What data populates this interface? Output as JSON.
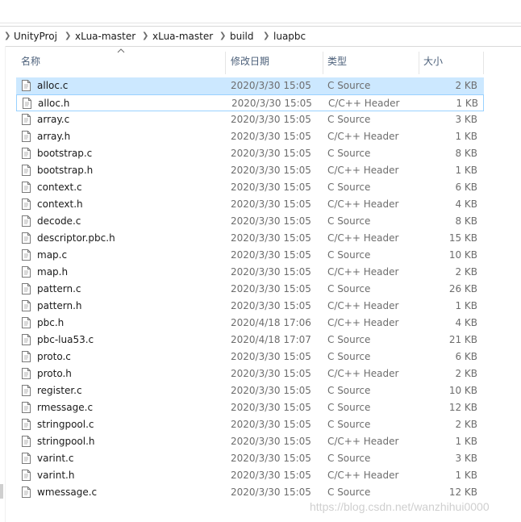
{
  "breadcrumb": [
    "UnityProj",
    "xLua-master",
    "xLua-master",
    "build",
    "luapbc"
  ],
  "columns": {
    "name": "名称",
    "date": "修改日期",
    "type": "类型",
    "size": "大小"
  },
  "files": [
    {
      "name": "alloc.c",
      "date": "2020/3/30 15:05",
      "type": "C Source",
      "size": "2 KB"
    },
    {
      "name": "alloc.h",
      "date": "2020/3/30 15:05",
      "type": "C/C++ Header",
      "size": "1 KB"
    },
    {
      "name": "array.c",
      "date": "2020/3/30 15:05",
      "type": "C Source",
      "size": "3 KB"
    },
    {
      "name": "array.h",
      "date": "2020/3/30 15:05",
      "type": "C/C++ Header",
      "size": "1 KB"
    },
    {
      "name": "bootstrap.c",
      "date": "2020/3/30 15:05",
      "type": "C Source",
      "size": "8 KB"
    },
    {
      "name": "bootstrap.h",
      "date": "2020/3/30 15:05",
      "type": "C/C++ Header",
      "size": "1 KB"
    },
    {
      "name": "context.c",
      "date": "2020/3/30 15:05",
      "type": "C Source",
      "size": "6 KB"
    },
    {
      "name": "context.h",
      "date": "2020/3/30 15:05",
      "type": "C/C++ Header",
      "size": "4 KB"
    },
    {
      "name": "decode.c",
      "date": "2020/3/30 15:05",
      "type": "C Source",
      "size": "8 KB"
    },
    {
      "name": "descriptor.pbc.h",
      "date": "2020/3/30 15:05",
      "type": "C/C++ Header",
      "size": "15 KB"
    },
    {
      "name": "map.c",
      "date": "2020/3/30 15:05",
      "type": "C Source",
      "size": "10 KB"
    },
    {
      "name": "map.h",
      "date": "2020/3/30 15:05",
      "type": "C/C++ Header",
      "size": "2 KB"
    },
    {
      "name": "pattern.c",
      "date": "2020/3/30 15:05",
      "type": "C Source",
      "size": "26 KB"
    },
    {
      "name": "pattern.h",
      "date": "2020/3/30 15:05",
      "type": "C/C++ Header",
      "size": "1 KB"
    },
    {
      "name": "pbc.h",
      "date": "2020/4/18 17:06",
      "type": "C/C++ Header",
      "size": "4 KB"
    },
    {
      "name": "pbc-lua53.c",
      "date": "2020/4/18 17:07",
      "type": "C Source",
      "size": "21 KB"
    },
    {
      "name": "proto.c",
      "date": "2020/3/30 15:05",
      "type": "C Source",
      "size": "6 KB"
    },
    {
      "name": "proto.h",
      "date": "2020/3/30 15:05",
      "type": "C/C++ Header",
      "size": "2 KB"
    },
    {
      "name": "register.c",
      "date": "2020/3/30 15:05",
      "type": "C Source",
      "size": "10 KB"
    },
    {
      "name": "rmessage.c",
      "date": "2020/3/30 15:05",
      "type": "C Source",
      "size": "12 KB"
    },
    {
      "name": "stringpool.c",
      "date": "2020/3/30 15:05",
      "type": "C Source",
      "size": "2 KB"
    },
    {
      "name": "stringpool.h",
      "date": "2020/3/30 15:05",
      "type": "C/C++ Header",
      "size": "1 KB"
    },
    {
      "name": "varint.c",
      "date": "2020/3/30 15:05",
      "type": "C Source",
      "size": "3 KB"
    },
    {
      "name": "varint.h",
      "date": "2020/3/30 15:05",
      "type": "C/C++ Header",
      "size": "1 KB"
    },
    {
      "name": "wmessage.c",
      "date": "2020/3/30 15:05",
      "type": "C Source",
      "size": "12 KB"
    }
  ],
  "selected_row": 0,
  "focused_row": 1,
  "watermark": "https://blog.csdn.net/wanzhihui0000",
  "icons": {
    "separator": "chevron-right-icon",
    "sort": "sort-ascending-icon",
    "file": "file-icon"
  },
  "colors": {
    "selection": "#cce8ff",
    "focus_border": "#99d1ff",
    "header_text": "#4c607a"
  }
}
